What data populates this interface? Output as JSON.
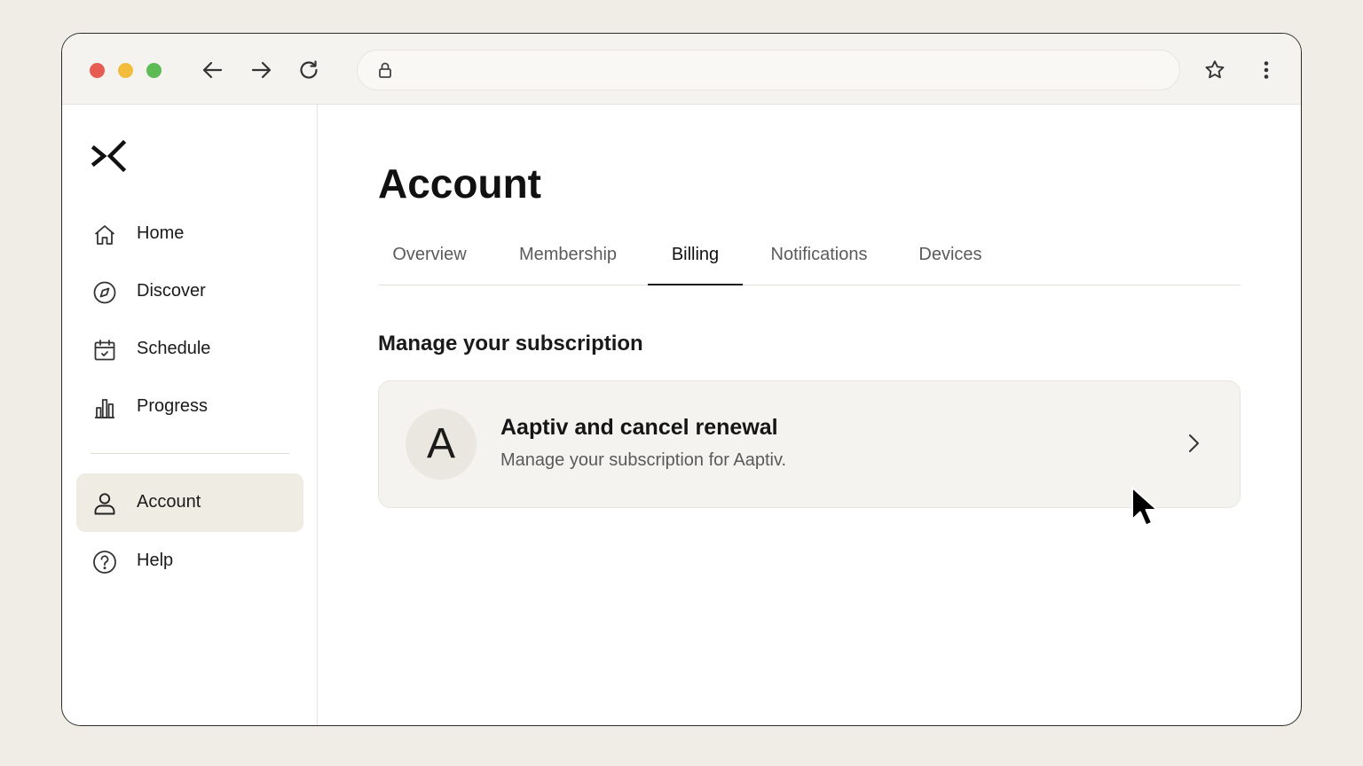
{
  "browser": {
    "address_value": "",
    "address_placeholder": "",
    "icons": [
      "back-icon",
      "forward-icon",
      "reload-icon",
      "lock-icon",
      "star-icon",
      "more-vertical-icon"
    ],
    "traffic_lights": {
      "close": "#e65b52",
      "minimize": "#f2bd3c",
      "maximize": "#5dbb56"
    }
  },
  "sidebar": {
    "items": [
      {
        "label": "Home",
        "icon": "home-icon"
      },
      {
        "label": "Discover",
        "icon": "compass-icon"
      },
      {
        "label": "Schedule",
        "icon": "calendar-icon"
      },
      {
        "label": "Progress",
        "icon": "bar-chart-icon"
      },
      {
        "label": "Account",
        "icon": "user-icon",
        "active": true
      },
      {
        "label": "Help",
        "icon": "help-circle-icon"
      }
    ]
  },
  "main": {
    "title": "Account",
    "tabs": [
      {
        "label": "Overview"
      },
      {
        "label": "Membership"
      },
      {
        "label": "Billing",
        "active": true
      },
      {
        "label": "Notifications"
      },
      {
        "label": "Devices"
      }
    ],
    "section_title": "Manage your subscription",
    "card": {
      "avatar_letter": "A",
      "title": "Aaptiv and cancel renewal",
      "subtitle": "Manage your subscription for Aaptiv."
    }
  },
  "colors": {
    "page_background": "#efede6",
    "active_item_background": "#efece4",
    "card_background": "#f4f3ef"
  }
}
